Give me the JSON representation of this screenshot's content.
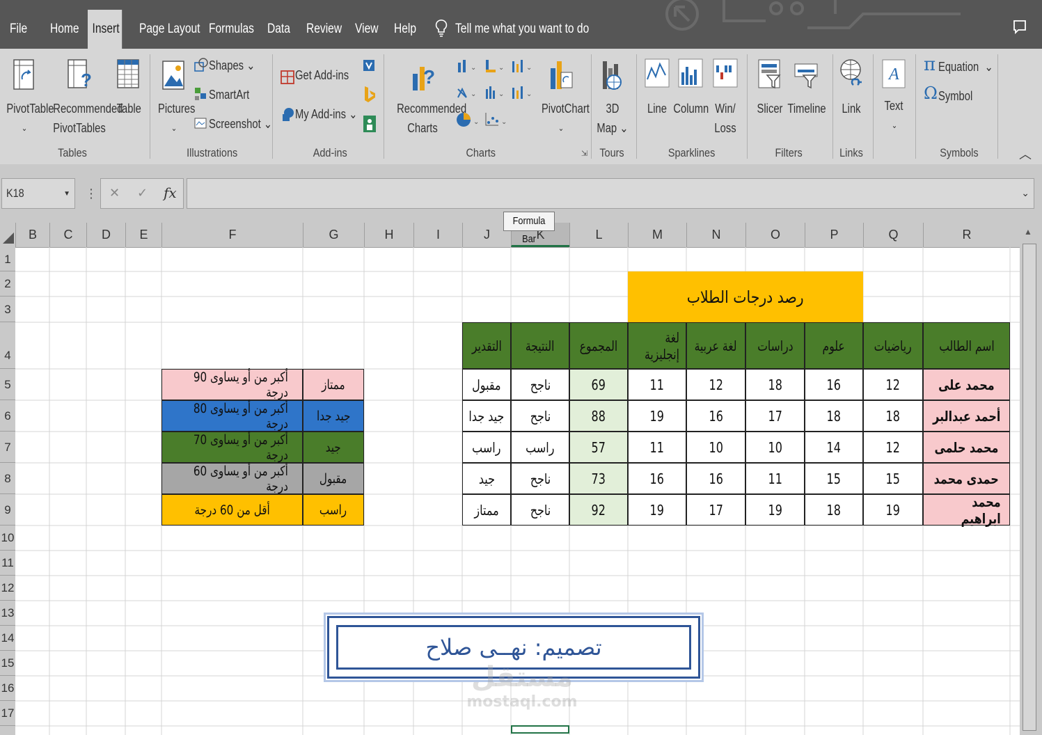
{
  "tabs": [
    "File",
    "Home",
    "Insert",
    "Page Layout",
    "Formulas",
    "Data",
    "Review",
    "View",
    "Help"
  ],
  "tell_me": "Tell me what you want to do",
  "ribbon": {
    "pivottable": "PivotTable",
    "recommended_pivot_1": "Recommended",
    "recommended_pivot_2": "PivotTables",
    "table": "Table",
    "pictures": "Pictures",
    "shapes": "Shapes",
    "smartart": "SmartArt",
    "screenshot": "Screenshot",
    "get_addins": "Get Add-ins",
    "my_addins": "My Add-ins",
    "recommended_charts_1": "Recommended",
    "recommended_charts_2": "Charts",
    "pivotchart": "PivotChart",
    "map_1": "3D",
    "map_2": "Map",
    "line": "Line",
    "column": "Column",
    "winloss_1": "Win/",
    "winloss_2": "Loss",
    "slicer": "Slicer",
    "timeline": "Timeline",
    "link": "Link",
    "text": "Text",
    "equation": "Equation",
    "symbol": "Symbol",
    "groups": {
      "tables": "Tables",
      "illustrations": "Illustrations",
      "addins": "Add-ins",
      "charts": "Charts",
      "tours": "Tours",
      "sparklines": "Sparklines",
      "filters": "Filters",
      "links": "Links",
      "symbols": "Symbols"
    }
  },
  "formula_bar": {
    "name_box": "K18",
    "fx": "fx",
    "tooltip": "Formula Bar",
    "cancel": "✕",
    "enter": "✓"
  },
  "columns": [
    "B",
    "C",
    "D",
    "E",
    "F",
    "G",
    "H",
    "I",
    "J",
    "K",
    "L",
    "M",
    "N",
    "O",
    "P",
    "Q",
    "R"
  ],
  "rows": [
    "1",
    "2",
    "3",
    "4",
    "5",
    "6",
    "7",
    "8",
    "9",
    "10",
    "11",
    "12",
    "13",
    "14",
    "15",
    "16",
    "17"
  ],
  "sheet": {
    "title": "رصد درجات الطلاب",
    "headers": [
      "اسم الطالب",
      "رياضيات",
      "علوم",
      "دراسات",
      "لغة عربية",
      "لغة إنجليزية",
      "المجموع",
      "النتيجة",
      "التقدير"
    ],
    "students": [
      [
        "محمد على",
        "12",
        "16",
        "18",
        "12",
        "11",
        "69",
        "ناجح",
        "مقبول"
      ],
      [
        "أحمد عبدالبر",
        "18",
        "18",
        "17",
        "16",
        "19",
        "88",
        "ناجح",
        "جيد جدا"
      ],
      [
        "محمد حلمى",
        "12",
        "14",
        "10",
        "10",
        "11",
        "57",
        "راسب",
        "راسب"
      ],
      [
        "حمدى محمد",
        "15",
        "15",
        "11",
        "16",
        "16",
        "73",
        "ناجح",
        "جيد"
      ],
      [
        "محمد ابراهيم",
        "19",
        "18",
        "19",
        "17",
        "19",
        "92",
        "ناجح",
        "ممتاز"
      ]
    ],
    "legend": [
      {
        "grade": "ممتاز",
        "rule": "أكبر من أو يساوى 90 درجة",
        "color": "#f8c9cc"
      },
      {
        "grade": "جيد جدا",
        "rule": "أكبر من أو يساوى 80 درجة",
        "color": "#2f75c9"
      },
      {
        "grade": "جيد",
        "rule": "أكبر من أو يساوى 70 درجة",
        "color": "#4a7d2a"
      },
      {
        "grade": "مقبول",
        "rule": "أكبر من أو يساوى 60 درجة",
        "color": "#a6a6a6"
      },
      {
        "grade": "راسب",
        "rule": "أقل من 60 درجة",
        "color": "#ffc000"
      }
    ],
    "designer": "تصميم: نهــى صلاح",
    "watermark_1": "مستقل",
    "watermark_2": "mostaql.com"
  },
  "colors": {
    "header_green": "#4a7d2a",
    "title_gold": "#ffc000",
    "name_pink": "#f8c9cc",
    "total_green": "#e2efd9",
    "ribbon": "#d6d6d6",
    "tabbar": "#565656"
  }
}
